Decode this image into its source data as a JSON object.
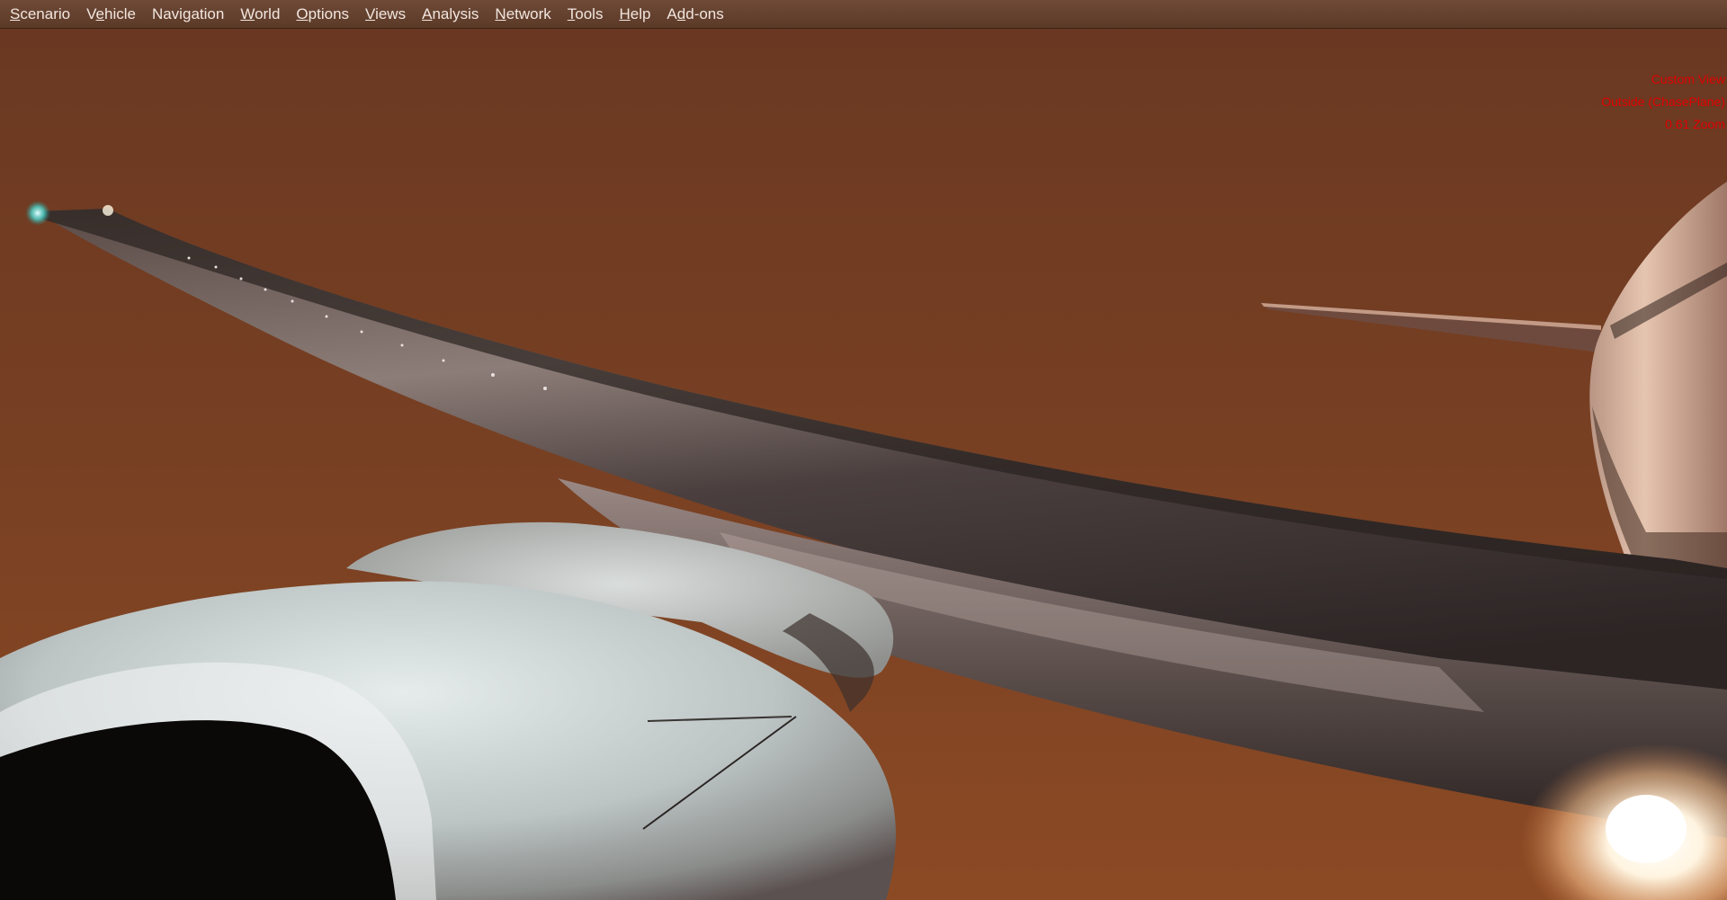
{
  "menu": {
    "items": [
      {
        "pre": "",
        "key": "S",
        "post": "cenario",
        "name": "menu-scenario"
      },
      {
        "pre": "V",
        "key": "e",
        "post": "hicle",
        "name": "menu-vehicle"
      },
      {
        "pre": "Navi",
        "key": "g",
        "post": "ation",
        "name": "menu-navigation"
      },
      {
        "pre": "",
        "key": "W",
        "post": "orld",
        "name": "menu-world"
      },
      {
        "pre": "",
        "key": "O",
        "post": "ptions",
        "name": "menu-options"
      },
      {
        "pre": "",
        "key": "V",
        "post": "iews",
        "name": "menu-views"
      },
      {
        "pre": "",
        "key": "A",
        "post": "nalysis",
        "name": "menu-analysis"
      },
      {
        "pre": "",
        "key": "N",
        "post": "etwork",
        "name": "menu-network"
      },
      {
        "pre": "",
        "key": "T",
        "post": "ools",
        "name": "menu-tools"
      },
      {
        "pre": "",
        "key": "H",
        "post": "elp",
        "name": "menu-help"
      },
      {
        "pre": "A",
        "key": "d",
        "post": "d-ons",
        "name": "menu-addons"
      }
    ]
  },
  "view_info": {
    "view_name": "Custom View",
    "camera": "Outside (ChasePlane)",
    "zoom": "0.61 Zoom"
  },
  "colors": {
    "sky_top": "#6e3c23",
    "sky_bottom": "#8a4a24",
    "overlay_text": "#e00000",
    "menu_bg": "#5c3a28",
    "menu_text": "#f1e6df"
  },
  "scene": {
    "objects": [
      "left-wing",
      "engine-nacelle",
      "fuselage",
      "horizontal-stabilizer",
      "wingtip-nav-light",
      "landing-light"
    ]
  }
}
